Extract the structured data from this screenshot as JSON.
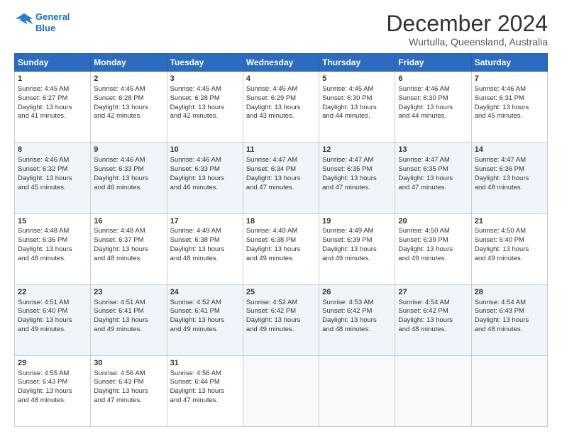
{
  "header": {
    "logo_line1": "General",
    "logo_line2": "Blue",
    "title": "December 2024",
    "subtitle": "Wurtulla, Queensland, Australia"
  },
  "days_of_week": [
    "Sunday",
    "Monday",
    "Tuesday",
    "Wednesday",
    "Thursday",
    "Friday",
    "Saturday"
  ],
  "weeks": [
    [
      {
        "day": 1,
        "lines": [
          "Sunrise: 4:45 AM",
          "Sunset: 6:27 PM",
          "Daylight: 13 hours",
          "and 41 minutes."
        ]
      },
      {
        "day": 2,
        "lines": [
          "Sunrise: 4:45 AM",
          "Sunset: 6:28 PM",
          "Daylight: 13 hours",
          "and 42 minutes."
        ]
      },
      {
        "day": 3,
        "lines": [
          "Sunrise: 4:45 AM",
          "Sunset: 6:28 PM",
          "Daylight: 13 hours",
          "and 42 minutes."
        ]
      },
      {
        "day": 4,
        "lines": [
          "Sunrise: 4:45 AM",
          "Sunset: 6:29 PM",
          "Daylight: 13 hours",
          "and 43 minutes."
        ]
      },
      {
        "day": 5,
        "lines": [
          "Sunrise: 4:45 AM",
          "Sunset: 6:30 PM",
          "Daylight: 13 hours",
          "and 44 minutes."
        ]
      },
      {
        "day": 6,
        "lines": [
          "Sunrise: 4:46 AM",
          "Sunset: 6:30 PM",
          "Daylight: 13 hours",
          "and 44 minutes."
        ]
      },
      {
        "day": 7,
        "lines": [
          "Sunrise: 4:46 AM",
          "Sunset: 6:31 PM",
          "Daylight: 13 hours",
          "and 45 minutes."
        ]
      }
    ],
    [
      {
        "day": 8,
        "lines": [
          "Sunrise: 4:46 AM",
          "Sunset: 6:32 PM",
          "Daylight: 13 hours",
          "and 45 minutes."
        ]
      },
      {
        "day": 9,
        "lines": [
          "Sunrise: 4:46 AM",
          "Sunset: 6:33 PM",
          "Daylight: 13 hours",
          "and 46 minutes."
        ]
      },
      {
        "day": 10,
        "lines": [
          "Sunrise: 4:46 AM",
          "Sunset: 6:33 PM",
          "Daylight: 13 hours",
          "and 46 minutes."
        ]
      },
      {
        "day": 11,
        "lines": [
          "Sunrise: 4:47 AM",
          "Sunset: 6:34 PM",
          "Daylight: 13 hours",
          "and 47 minutes."
        ]
      },
      {
        "day": 12,
        "lines": [
          "Sunrise: 4:47 AM",
          "Sunset: 6:35 PM",
          "Daylight: 13 hours",
          "and 47 minutes."
        ]
      },
      {
        "day": 13,
        "lines": [
          "Sunrise: 4:47 AM",
          "Sunset: 6:35 PM",
          "Daylight: 13 hours",
          "and 47 minutes."
        ]
      },
      {
        "day": 14,
        "lines": [
          "Sunrise: 4:47 AM",
          "Sunset: 6:36 PM",
          "Daylight: 13 hours",
          "and 48 minutes."
        ]
      }
    ],
    [
      {
        "day": 15,
        "lines": [
          "Sunrise: 4:48 AM",
          "Sunset: 6:36 PM",
          "Daylight: 13 hours",
          "and 48 minutes."
        ]
      },
      {
        "day": 16,
        "lines": [
          "Sunrise: 4:48 AM",
          "Sunset: 6:37 PM",
          "Daylight: 13 hours",
          "and 48 minutes."
        ]
      },
      {
        "day": 17,
        "lines": [
          "Sunrise: 4:49 AM",
          "Sunset: 6:38 PM",
          "Daylight: 13 hours",
          "and 48 minutes."
        ]
      },
      {
        "day": 18,
        "lines": [
          "Sunrise: 4:49 AM",
          "Sunset: 6:38 PM",
          "Daylight: 13 hours",
          "and 49 minutes."
        ]
      },
      {
        "day": 19,
        "lines": [
          "Sunrise: 4:49 AM",
          "Sunset: 6:39 PM",
          "Daylight: 13 hours",
          "and 49 minutes."
        ]
      },
      {
        "day": 20,
        "lines": [
          "Sunrise: 4:50 AM",
          "Sunset: 6:39 PM",
          "Daylight: 13 hours",
          "and 49 minutes."
        ]
      },
      {
        "day": 21,
        "lines": [
          "Sunrise: 4:50 AM",
          "Sunset: 6:40 PM",
          "Daylight: 13 hours",
          "and 49 minutes."
        ]
      }
    ],
    [
      {
        "day": 22,
        "lines": [
          "Sunrise: 4:51 AM",
          "Sunset: 6:40 PM",
          "Daylight: 13 hours",
          "and 49 minutes."
        ]
      },
      {
        "day": 23,
        "lines": [
          "Sunrise: 4:51 AM",
          "Sunset: 6:41 PM",
          "Daylight: 13 hours",
          "and 49 minutes."
        ]
      },
      {
        "day": 24,
        "lines": [
          "Sunrise: 4:52 AM",
          "Sunset: 6:41 PM",
          "Daylight: 13 hours",
          "and 49 minutes."
        ]
      },
      {
        "day": 25,
        "lines": [
          "Sunrise: 4:52 AM",
          "Sunset: 6:42 PM",
          "Daylight: 13 hours",
          "and 49 minutes."
        ]
      },
      {
        "day": 26,
        "lines": [
          "Sunrise: 4:53 AM",
          "Sunset: 6:42 PM",
          "Daylight: 13 hours",
          "and 48 minutes."
        ]
      },
      {
        "day": 27,
        "lines": [
          "Sunrise: 4:54 AM",
          "Sunset: 6:42 PM",
          "Daylight: 13 hours",
          "and 48 minutes."
        ]
      },
      {
        "day": 28,
        "lines": [
          "Sunrise: 4:54 AM",
          "Sunset: 6:43 PM",
          "Daylight: 13 hours",
          "and 48 minutes."
        ]
      }
    ],
    [
      {
        "day": 29,
        "lines": [
          "Sunrise: 4:55 AM",
          "Sunset: 6:43 PM",
          "Daylight: 13 hours",
          "and 48 minutes."
        ]
      },
      {
        "day": 30,
        "lines": [
          "Sunrise: 4:56 AM",
          "Sunset: 6:43 PM",
          "Daylight: 13 hours",
          "and 47 minutes."
        ]
      },
      {
        "day": 31,
        "lines": [
          "Sunrise: 4:56 AM",
          "Sunset: 6:44 PM",
          "Daylight: 13 hours",
          "and 47 minutes."
        ]
      },
      null,
      null,
      null,
      null
    ]
  ]
}
